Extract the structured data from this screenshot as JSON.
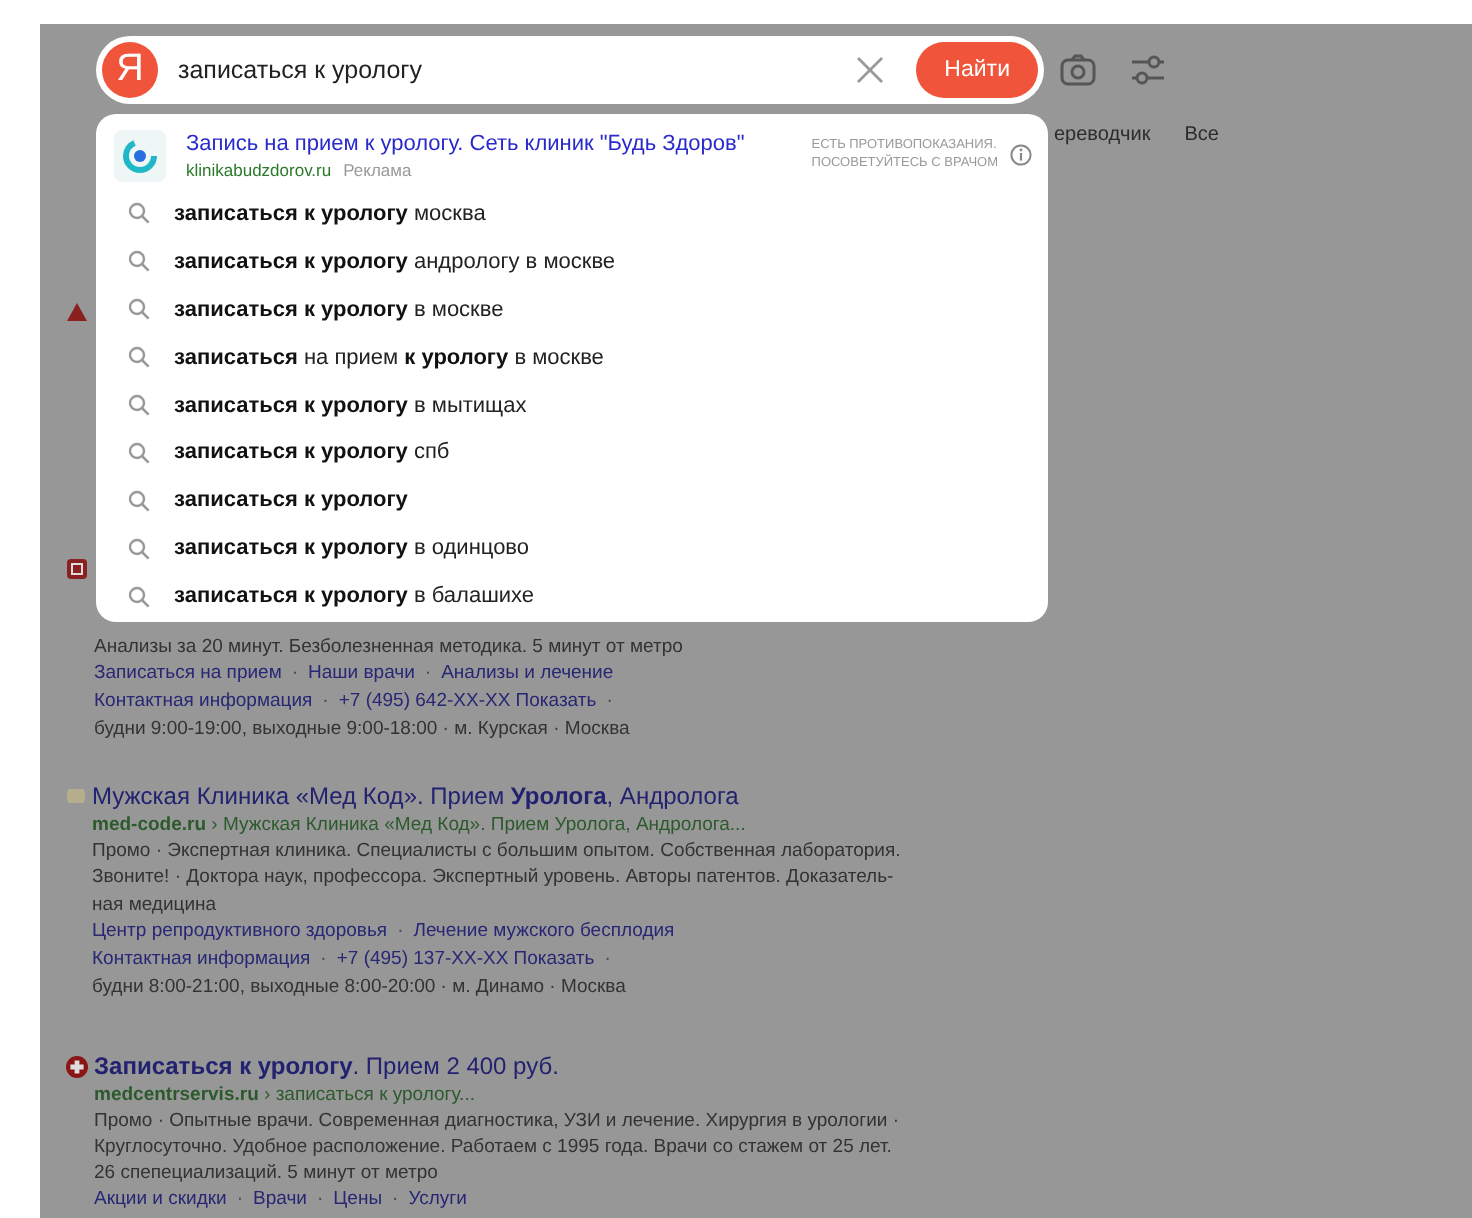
{
  "search": {
    "logo": "Я",
    "query": "записаться к урологу",
    "button": "Найти"
  },
  "tabs": [
    {
      "label": "ереводчик",
      "selected": false
    },
    {
      "label": "Все",
      "selected": false
    }
  ],
  "suggest": {
    "ad": {
      "title": "Запись на прием к урологу. Сеть клиник \"Будь Здоров\"",
      "domain": "klinikabudzdorov.ru",
      "label": "Реклама",
      "warning": [
        "ЕСТЬ ПРОТИВОПОКАЗАНИЯ.",
        "ПОСОВЕТУЙТЕСЬ С ВРАЧОМ"
      ]
    },
    "items": [
      "**записаться к урологу** москва",
      "**записаться к урологу** андрологу в москве",
      "**записаться к урологу** в москве",
      "**записаться** на прием **к урологу** в москве",
      "**записаться к урологу** в мытищах",
      "**записаться к урологу** спб",
      "**записаться к урологу**",
      "**записаться к урологу** в одинцово",
      "**записаться к урологу** в балашихе"
    ]
  },
  "results": [
    {
      "kind": "warning"
    },
    {
      "kind": "clinic",
      "snippet": [
        "Анализы за 20 минут. Безболезненная методика. 5 минут от метро"
      ],
      "link_rows": [
        [
          {
            "kind": "link",
            "text": "Записаться на прием"
          },
          {
            "kind": "sep",
            "text": "·"
          },
          {
            "kind": "link",
            "text": "Наши врачи"
          },
          {
            "kind": "sep",
            "text": "·"
          },
          {
            "kind": "link",
            "text": "Анализы и лечение"
          }
        ],
        [
          {
            "kind": "link",
            "text": "Контактная информация"
          },
          {
            "kind": "sep",
            "text": "·"
          },
          {
            "kind": "link",
            "text": "+7 (495) 642-XX-XX Показать"
          },
          {
            "kind": "sep",
            "text": "·"
          }
        ]
      ],
      "info": "будни 9:00-19:00, выходные 9:00-18:00 · м. Курская · Москва"
    },
    {
      "kind": "site",
      "title": "Мужская Клиника «Мед Код». Прием **Уролога**, Андролога",
      "domain": "med-code.ru",
      "path": "› Мужская Клиника «Мед Код». Прием Уролога, Андролога...",
      "snippet": [
        "Промо · Экспертная клиника. Специалисты с большим опытом. Собственная лаборатория.",
        "Звоните! · Доктора наук, профессора. Экспертный уровень. Авторы патентов. Доказатель-",
        "ная медицина"
      ],
      "link_rows": [
        [
          {
            "kind": "link",
            "text": "Центр репродуктивного здоровья"
          },
          {
            "kind": "sep",
            "text": "·"
          },
          {
            "kind": "link",
            "text": "Лечение мужского бесплодия"
          }
        ],
        [
          {
            "kind": "link",
            "text": "Контактная информация"
          },
          {
            "kind": "sep",
            "text": "·"
          },
          {
            "kind": "link",
            "text": "+7 (495) 137-XX-XX Показать"
          },
          {
            "kind": "sep",
            "text": "·"
          }
        ]
      ],
      "info": "будни 8:00-21:00, выходные 8:00-20:00 · м. Динамо · Москва"
    },
    {
      "kind": "medical",
      "title": "**Записаться к урологу**. Прием 2 400 руб.",
      "domain": "medcentrservis.ru",
      "path": "› записаться к урологу...",
      "snippet": [
        "Промо · Опытные врачи. Современная диагностика, УЗИ и лечение. Хирургия в урологии ·",
        "Круглосуточно. Удобное расположение. Работаем с 1995 года. Врачи со стажем от 25 лет.",
        "26 спепециализаций. 5 минут от метро"
      ],
      "link_rows": [
        [
          {
            "kind": "link",
            "text": "Акции и скидки"
          },
          {
            "kind": "sep",
            "text": "·"
          },
          {
            "kind": "link",
            "text": "Врачи"
          },
          {
            "kind": "sep",
            "text": "·"
          },
          {
            "kind": "link",
            "text": "Цены"
          },
          {
            "kind": "sep",
            "text": "·"
          },
          {
            "kind": "link",
            "text": "Услуги"
          }
        ]
      ]
    }
  ]
}
